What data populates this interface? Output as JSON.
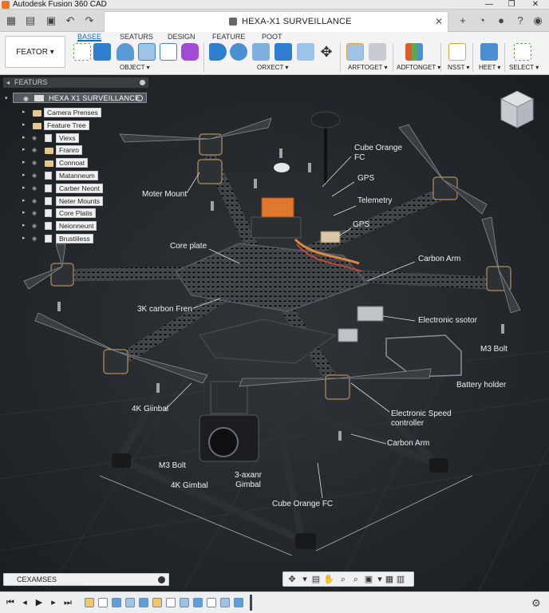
{
  "window": {
    "title": "Autodesk Fusion 360 CAD"
  },
  "document": {
    "title": "HEXA-X1 SURVEILLANCE"
  },
  "ribbon": {
    "workspace": "FEATOR ▾",
    "tabs": [
      "BASEE",
      "SEATURS",
      "DESIGN",
      "FEATURE",
      "POOT"
    ],
    "groups": [
      "OBJECT ▾",
      "ORXECT ▾",
      "ARFTOGET ▾",
      "ADFTONGET ▾",
      "NSST ▾",
      "HEET ▾",
      "SELECT ▾"
    ]
  },
  "browser": {
    "header": "FEATURS",
    "root": "HEXA X1 SURVEILLANCE",
    "items": [
      "Camera Prenses",
      "Feature Tree",
      "Viexs",
      "Franro",
      "Connoat",
      "Matanneum",
      "Carber Neont",
      "Neter Mounts",
      "Core Platis",
      "Neionneunt",
      "Brustiiless"
    ]
  },
  "annotations": {
    "cube_orange_fc_top": "Cube Orange\nFC",
    "gps_1": "GPS",
    "telemetry": "Telemetry",
    "gps_2": "GPS",
    "moter_mount": "Moter Mount",
    "core_plate": "Core plate",
    "carbon_arm_1": "Carbon Arm",
    "carbon_fren": "3K carbon Fren",
    "electronic_ssotor": "Electronic ssotor",
    "m3_bolt_1": "M3 Bolt",
    "battery_holder": "Battery holder",
    "gimbal_4k_1": "4K Giinbal",
    "esc": "Electronic Speed\ncontroller",
    "carbon_arm_2": "Carbon Arm",
    "m3_bolt_2": "M3 Bolt",
    "gimbal_4k_2": "4K Gimbal",
    "gimbal_3axis": "3-axanr\nGimbal",
    "cube_orange_fc_bottom": "Cube Orange FC"
  },
  "comments": {
    "label": "CEXAMSES"
  },
  "colors": {
    "accent": "#0d6fbf",
    "canvas": "#262a2e",
    "fc_orange": "#e0782f"
  }
}
